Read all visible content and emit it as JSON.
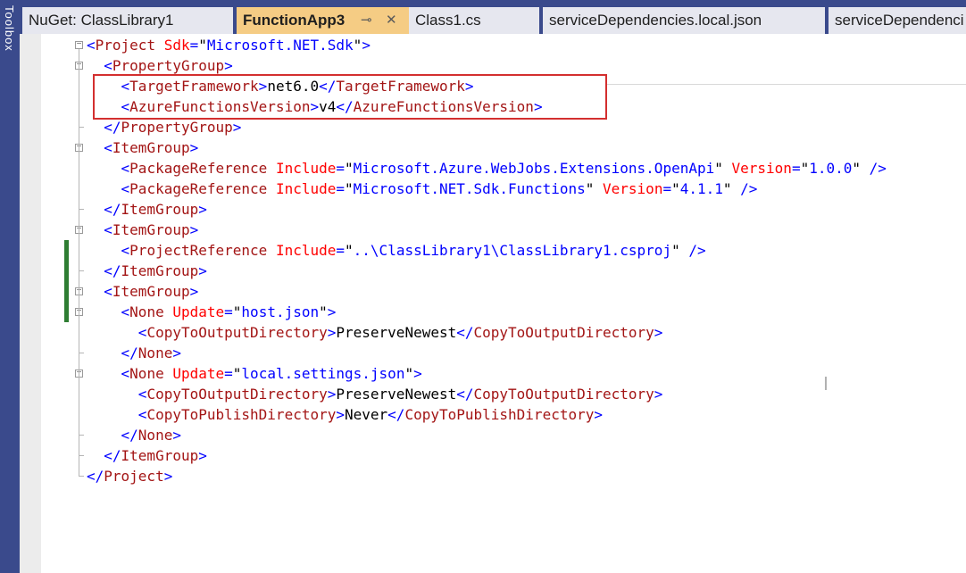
{
  "sidebar": {
    "toolbox_label": "Toolbox"
  },
  "tabs": [
    {
      "label": "NuGet: ClassLibrary1",
      "active": false
    },
    {
      "label": "FunctionApp3",
      "active": true,
      "pin_icon": "pin-icon",
      "close_icon": "close-icon"
    },
    {
      "label": "Class1.cs",
      "active": false
    },
    {
      "label": "serviceDependencies.local.json",
      "active": false
    },
    {
      "label": "serviceDependenci",
      "active": false
    }
  ],
  "tab_glyphs": {
    "pin": "⊸",
    "close": "✕"
  },
  "editor": {
    "lines": [
      [
        {
          "c": "b",
          "t": "<"
        },
        {
          "c": "t",
          "t": "Project"
        },
        {
          "c": "x",
          "t": " "
        },
        {
          "c": "a",
          "t": "Sdk"
        },
        {
          "c": "b",
          "t": "="
        },
        {
          "c": "x",
          "t": "\""
        },
        {
          "c": "v",
          "t": "Microsoft.NET.Sdk"
        },
        {
          "c": "x",
          "t": "\""
        },
        {
          "c": "b",
          "t": ">"
        }
      ],
      [
        {
          "c": "x",
          "t": "  "
        },
        {
          "c": "b",
          "t": "<"
        },
        {
          "c": "t",
          "t": "PropertyGroup"
        },
        {
          "c": "b",
          "t": ">"
        }
      ],
      [
        {
          "c": "x",
          "t": "    "
        },
        {
          "c": "b",
          "t": "<"
        },
        {
          "c": "t",
          "t": "TargetFramework"
        },
        {
          "c": "b",
          "t": ">"
        },
        {
          "c": "x",
          "t": "net6.0"
        },
        {
          "c": "b",
          "t": "</"
        },
        {
          "c": "t",
          "t": "TargetFramework"
        },
        {
          "c": "b",
          "t": ">"
        }
      ],
      [
        {
          "c": "x",
          "t": "    "
        },
        {
          "c": "b",
          "t": "<"
        },
        {
          "c": "t",
          "t": "AzureFunctionsVersion"
        },
        {
          "c": "b",
          "t": ">"
        },
        {
          "c": "x",
          "t": "v4"
        },
        {
          "c": "b",
          "t": "</"
        },
        {
          "c": "t",
          "t": "AzureFunctionsVersion"
        },
        {
          "c": "b",
          "t": ">"
        }
      ],
      [
        {
          "c": "x",
          "t": "  "
        },
        {
          "c": "b",
          "t": "</"
        },
        {
          "c": "t",
          "t": "PropertyGroup"
        },
        {
          "c": "b",
          "t": ">"
        }
      ],
      [
        {
          "c": "x",
          "t": "  "
        },
        {
          "c": "b",
          "t": "<"
        },
        {
          "c": "t",
          "t": "ItemGroup"
        },
        {
          "c": "b",
          "t": ">"
        }
      ],
      [
        {
          "c": "x",
          "t": "    "
        },
        {
          "c": "b",
          "t": "<"
        },
        {
          "c": "t",
          "t": "PackageReference"
        },
        {
          "c": "x",
          "t": " "
        },
        {
          "c": "a",
          "t": "Include"
        },
        {
          "c": "b",
          "t": "="
        },
        {
          "c": "x",
          "t": "\""
        },
        {
          "c": "v",
          "t": "Microsoft.Azure.WebJobs.Extensions.OpenApi"
        },
        {
          "c": "x",
          "t": "\" "
        },
        {
          "c": "a",
          "t": "Version"
        },
        {
          "c": "b",
          "t": "="
        },
        {
          "c": "x",
          "t": "\""
        },
        {
          "c": "v",
          "t": "1.0.0"
        },
        {
          "c": "x",
          "t": "\" "
        },
        {
          "c": "b",
          "t": "/>"
        }
      ],
      [
        {
          "c": "x",
          "t": "    "
        },
        {
          "c": "b",
          "t": "<"
        },
        {
          "c": "t",
          "t": "PackageReference"
        },
        {
          "c": "x",
          "t": " "
        },
        {
          "c": "a",
          "t": "Include"
        },
        {
          "c": "b",
          "t": "="
        },
        {
          "c": "x",
          "t": "\""
        },
        {
          "c": "v",
          "t": "Microsoft.NET.Sdk.Functions"
        },
        {
          "c": "x",
          "t": "\" "
        },
        {
          "c": "a",
          "t": "Version"
        },
        {
          "c": "b",
          "t": "="
        },
        {
          "c": "x",
          "t": "\""
        },
        {
          "c": "v",
          "t": "4.1.1"
        },
        {
          "c": "x",
          "t": "\" "
        },
        {
          "c": "b",
          "t": "/>"
        }
      ],
      [
        {
          "c": "x",
          "t": "  "
        },
        {
          "c": "b",
          "t": "</"
        },
        {
          "c": "t",
          "t": "ItemGroup"
        },
        {
          "c": "b",
          "t": ">"
        }
      ],
      [
        {
          "c": "x",
          "t": "  "
        },
        {
          "c": "b",
          "t": "<"
        },
        {
          "c": "t",
          "t": "ItemGroup"
        },
        {
          "c": "b",
          "t": ">"
        }
      ],
      [
        {
          "c": "x",
          "t": "    "
        },
        {
          "c": "b",
          "t": "<"
        },
        {
          "c": "t",
          "t": "ProjectReference"
        },
        {
          "c": "x",
          "t": " "
        },
        {
          "c": "a",
          "t": "Include"
        },
        {
          "c": "b",
          "t": "="
        },
        {
          "c": "x",
          "t": "\""
        },
        {
          "c": "v",
          "t": "..\\ClassLibrary1\\ClassLibrary1.csproj"
        },
        {
          "c": "x",
          "t": "\" "
        },
        {
          "c": "b",
          "t": "/>"
        }
      ],
      [
        {
          "c": "x",
          "t": "  "
        },
        {
          "c": "b",
          "t": "</"
        },
        {
          "c": "t",
          "t": "ItemGroup"
        },
        {
          "c": "b",
          "t": ">"
        }
      ],
      [
        {
          "c": "x",
          "t": "  "
        },
        {
          "c": "b",
          "t": "<"
        },
        {
          "c": "t",
          "t": "ItemGroup"
        },
        {
          "c": "b",
          "t": ">"
        }
      ],
      [
        {
          "c": "x",
          "t": "    "
        },
        {
          "c": "b",
          "t": "<"
        },
        {
          "c": "t",
          "t": "None"
        },
        {
          "c": "x",
          "t": " "
        },
        {
          "c": "a",
          "t": "Update"
        },
        {
          "c": "b",
          "t": "="
        },
        {
          "c": "x",
          "t": "\""
        },
        {
          "c": "v",
          "t": "host.json"
        },
        {
          "c": "x",
          "t": "\""
        },
        {
          "c": "b",
          "t": ">"
        }
      ],
      [
        {
          "c": "x",
          "t": "      "
        },
        {
          "c": "b",
          "t": "<"
        },
        {
          "c": "t",
          "t": "CopyToOutputDirectory"
        },
        {
          "c": "b",
          "t": ">"
        },
        {
          "c": "x",
          "t": "PreserveNewest"
        },
        {
          "c": "b",
          "t": "</"
        },
        {
          "c": "t",
          "t": "CopyToOutputDirectory"
        },
        {
          "c": "b",
          "t": ">"
        }
      ],
      [
        {
          "c": "x",
          "t": "    "
        },
        {
          "c": "b",
          "t": "</"
        },
        {
          "c": "t",
          "t": "None"
        },
        {
          "c": "b",
          "t": ">"
        }
      ],
      [
        {
          "c": "x",
          "t": "    "
        },
        {
          "c": "b",
          "t": "<"
        },
        {
          "c": "t",
          "t": "None"
        },
        {
          "c": "x",
          "t": " "
        },
        {
          "c": "a",
          "t": "Update"
        },
        {
          "c": "b",
          "t": "="
        },
        {
          "c": "x",
          "t": "\""
        },
        {
          "c": "v",
          "t": "local.settings.json"
        },
        {
          "c": "x",
          "t": "\""
        },
        {
          "c": "b",
          "t": ">"
        }
      ],
      [
        {
          "c": "x",
          "t": "      "
        },
        {
          "c": "b",
          "t": "<"
        },
        {
          "c": "t",
          "t": "CopyToOutputDirectory"
        },
        {
          "c": "b",
          "t": ">"
        },
        {
          "c": "x",
          "t": "PreserveNewest"
        },
        {
          "c": "b",
          "t": "</"
        },
        {
          "c": "t",
          "t": "CopyToOutputDirectory"
        },
        {
          "c": "b",
          "t": ">"
        }
      ],
      [
        {
          "c": "x",
          "t": "      "
        },
        {
          "c": "b",
          "t": "<"
        },
        {
          "c": "t",
          "t": "CopyToPublishDirectory"
        },
        {
          "c": "b",
          "t": ">"
        },
        {
          "c": "x",
          "t": "Never"
        },
        {
          "c": "b",
          "t": "</"
        },
        {
          "c": "t",
          "t": "CopyToPublishDirectory"
        },
        {
          "c": "b",
          "t": ">"
        }
      ],
      [
        {
          "c": "x",
          "t": "    "
        },
        {
          "c": "b",
          "t": "</"
        },
        {
          "c": "t",
          "t": "None"
        },
        {
          "c": "b",
          "t": ">"
        }
      ],
      [
        {
          "c": "x",
          "t": "  "
        },
        {
          "c": "b",
          "t": "</"
        },
        {
          "c": "t",
          "t": "ItemGroup"
        },
        {
          "c": "b",
          "t": ">"
        }
      ],
      [
        {
          "c": "b",
          "t": "</"
        },
        {
          "c": "t",
          "t": "Project"
        },
        {
          "c": "b",
          "t": ">"
        }
      ]
    ],
    "fold_markers": [
      0,
      1,
      5,
      9,
      12,
      13,
      16
    ],
    "changed_lines": [
      10,
      11,
      12,
      13
    ],
    "highlighted_lines": [
      2,
      3
    ],
    "highlight_color": "#d32f2f",
    "ibeam_icon": "text-cursor-icon",
    "ibeam_glyph": "I"
  },
  "colors": {
    "chrome": "#3a4a8c",
    "active_tab": "#f5cc84",
    "tag": "#a31515",
    "attribute": "#ff0000",
    "bracket": "#0000ff",
    "change_bar": "#2e7d32"
  }
}
